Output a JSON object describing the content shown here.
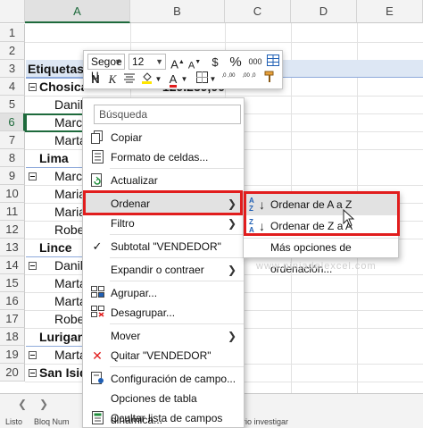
{
  "columns": [
    "A",
    "B",
    "C",
    "D",
    "E"
  ],
  "rows": [
    "1",
    "2",
    "3",
    "4",
    "5",
    "6",
    "7",
    "8",
    "9",
    "10",
    "11",
    "12",
    "13",
    "14",
    "15",
    "16",
    "17",
    "18",
    "19",
    "20"
  ],
  "cells": {
    "a3": "Etiquetas d",
    "a4": "Chosica",
    "b4": "129.239,00",
    "a5": "Danilo",
    "a6": "Marco",
    "a7": "Marta",
    "a8": "Lima",
    "a9": "Marco",
    "a10": "Maria",
    "a11": "Maria",
    "a12": "Rober",
    "a13": "Lince",
    "a14": "Danilo",
    "a15": "Marta",
    "a16": "Marta",
    "a17": "Rober",
    "a18": "Lurigan",
    "a19": "Marta",
    "a20": "San Isidr"
  },
  "minibar": {
    "font_name": "Segoe U",
    "font_size": "12",
    "grow_font": "A",
    "shrink_font": "A",
    "currency": "$",
    "percent": "%",
    "thousands": "000",
    "bold": "N",
    "italic": "K",
    "font_color_letter": "A",
    "inc_decimal": ",0 ,00",
    "dec_decimal": ",00 ,0"
  },
  "context_menu": {
    "search_placeholder": "Búsqueda",
    "items": [
      {
        "label": "Copiar",
        "icon": "copy-icon"
      },
      {
        "label": "Formato de celdas...",
        "icon": "format-cells-icon"
      },
      {
        "label": "Actualizar",
        "icon": "refresh-icon"
      },
      {
        "label": "Ordenar",
        "icon": "",
        "submenu": true
      },
      {
        "label": "Filtro",
        "icon": "",
        "submenu": true
      },
      {
        "label": "Subtotal \"VENDEDOR\"",
        "icon": "check-icon"
      },
      {
        "label": "Expandir o contraer",
        "icon": "",
        "submenu": true
      },
      {
        "label": "Agrupar...",
        "icon": "group-icon"
      },
      {
        "label": "Desagrupar...",
        "icon": "ungroup-icon"
      },
      {
        "label": "Mover",
        "icon": "",
        "submenu": true
      },
      {
        "label": "Quitar \"VENDEDOR\"",
        "icon": "remove-icon"
      },
      {
        "label": "Configuración de campo...",
        "icon": "field-settings-icon"
      },
      {
        "label": "Opciones de tabla dinámica...",
        "icon": ""
      },
      {
        "label": "Ocultar lista de campos",
        "icon": "field-list-icon"
      }
    ]
  },
  "submenu": {
    "items": [
      {
        "label": "Ordenar de A a Z",
        "icon_top": "A",
        "icon_bottom": "Z"
      },
      {
        "label": "Ordenar de Z a A",
        "icon_top": "Z",
        "icon_bottom": "A"
      },
      {
        "label": "Más opciones de ordenación..."
      }
    ]
  },
  "watermark": "www.ninjadelexcel.com",
  "status": {
    "ready": "Listo",
    "numlock": "Bloq Num",
    "right": "ario investigar"
  },
  "colors": {
    "accent_green": "#1e6a3c",
    "highlight_red": "#e11d1d",
    "pivot_header_bg": "#dde7f4",
    "pivot_border": "#8eaadb",
    "sort_icon_blue": "#1f5fb4"
  }
}
